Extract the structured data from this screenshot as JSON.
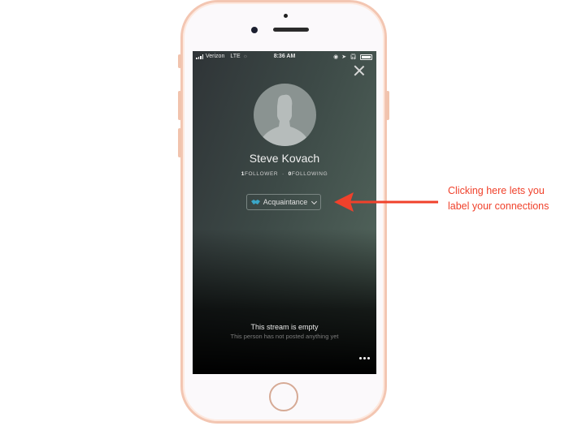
{
  "status_bar": {
    "carrier": "Verizon",
    "network": "LTE",
    "time": "8:36 AM"
  },
  "profile": {
    "name": "Steve Kovach",
    "followers_count": "1",
    "followers_label": "FOLLOWER",
    "separator": "·",
    "following_count": "0",
    "following_label": "FOLLOWING"
  },
  "relationship_button": {
    "label": "Acquaintance",
    "icon": "handshake-icon",
    "icon_color": "#3aa6c8"
  },
  "stream": {
    "empty_title": "This stream is empty",
    "empty_subtitle": "This person has not posted anything yet"
  },
  "annotation": {
    "text": "Clicking here lets you label your connections",
    "color": "#f0412b"
  }
}
